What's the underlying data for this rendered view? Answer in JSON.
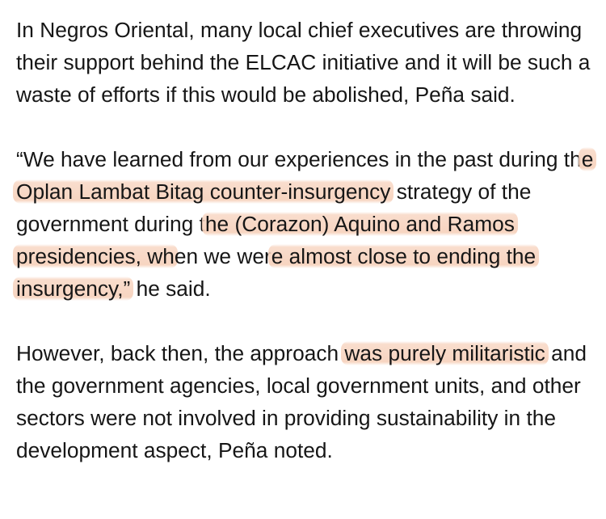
{
  "article": {
    "p1": "In Negros Oriental, many local chief executives are throwing their support behind the ELCAC initiative and it will be such a waste of efforts if this would be abolished, Peña said.",
    "p2": {
      "t1": "“We have learned from our experiences in the past during th",
      "h1": "e Oplan Lambat Bitag counter-insurgency",
      "t2": " strategy of the government during t",
      "h2": "he (Corazon) Aquino and Ramos presidencies, wh",
      "t3": "en we wer",
      "h3": "e almost close to ending the insurgency,”",
      "t4": " he said."
    },
    "p3": {
      "t1": "However, back then, the approach ",
      "h1": "was purely militaristic",
      "t2": " and the government agencies, local government units, and other sectors were not involved in providing sustainability in the development aspect, Peña noted."
    }
  },
  "colors": {
    "text": "#161616",
    "highlight": "#f6d0ba",
    "background": "#ffffff"
  }
}
